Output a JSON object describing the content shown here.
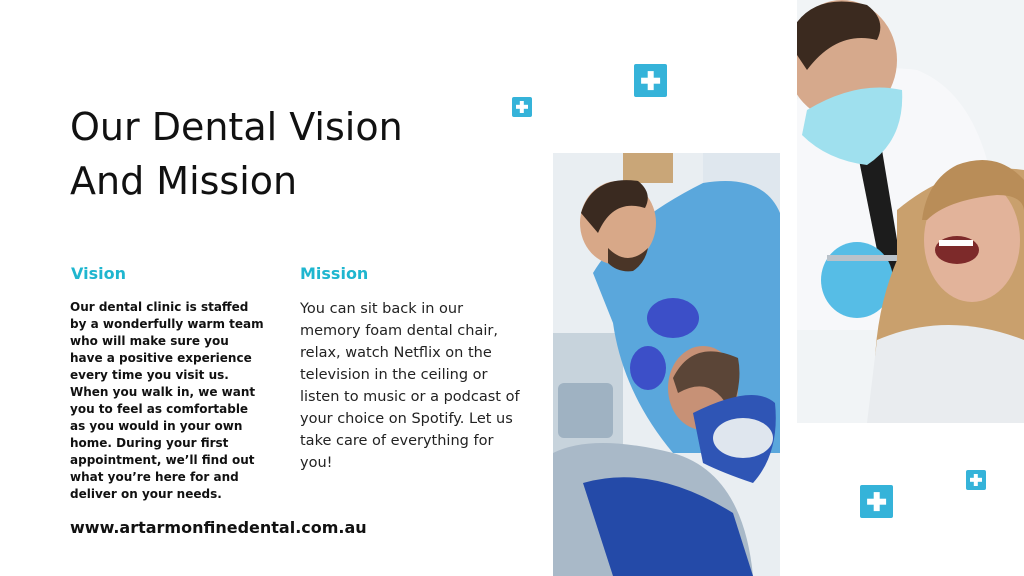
{
  "title": {
    "line1": "Our Dental Vision",
    "line2": "And Mission"
  },
  "vision": {
    "heading": "Vision",
    "text": "Our dental clinic is staffed by a wonderfully warm team who will make sure you have a positive experience every time you visit us. When you walk in, we want you to feel as comfortable as you would in your own home. During your first appointment, we’ll find out what you’re here for and deliver on your needs."
  },
  "mission": {
    "heading": "Mission",
    "text": "You can sit back in our memory foam dental chair, relax, watch Netflix on the television in the ceiling or listen to music or a podcast of your choice on Spotify. Let us take care of everything for you!"
  },
  "website": "www.artarmonfinedental.com.au",
  "colors": {
    "accent": "#1fb6cf",
    "plus_icon": "#35b3d9"
  },
  "icons": [
    "medical-plus-icon"
  ]
}
